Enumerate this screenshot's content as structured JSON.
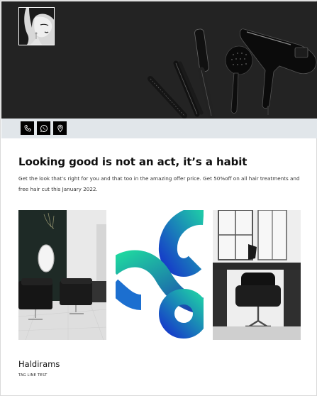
{
  "header": {
    "avatar_icon": "woman-portrait-photo",
    "banner_image": "hair-styling-tools-photo"
  },
  "contact": {
    "buttons": [
      {
        "icon": "phone-icon"
      },
      {
        "icon": "whatsapp-icon"
      },
      {
        "icon": "location-pin-icon"
      }
    ]
  },
  "offer": {
    "headline": "Looking good is not an act, it’s a habit",
    "description": "Get the look that’s right for you and that too in the amazing offer price. Get 50%off on all hair treatments and free hair cut this January 2022."
  },
  "gallery": {
    "images": [
      {
        "icon": "salon-interior-photo"
      },
      {
        "icon": "brand-logo-graphic"
      },
      {
        "icon": "salon-chair-photo"
      }
    ]
  },
  "footer": {
    "brand_name": "Haldirams",
    "tagline": "TAG LINE TEST"
  },
  "colors": {
    "banner_bg": "#232323",
    "strip_bg": "#e1e6ea",
    "logo_teal": "#1fc9a4",
    "logo_blue": "#1a3fb0"
  }
}
